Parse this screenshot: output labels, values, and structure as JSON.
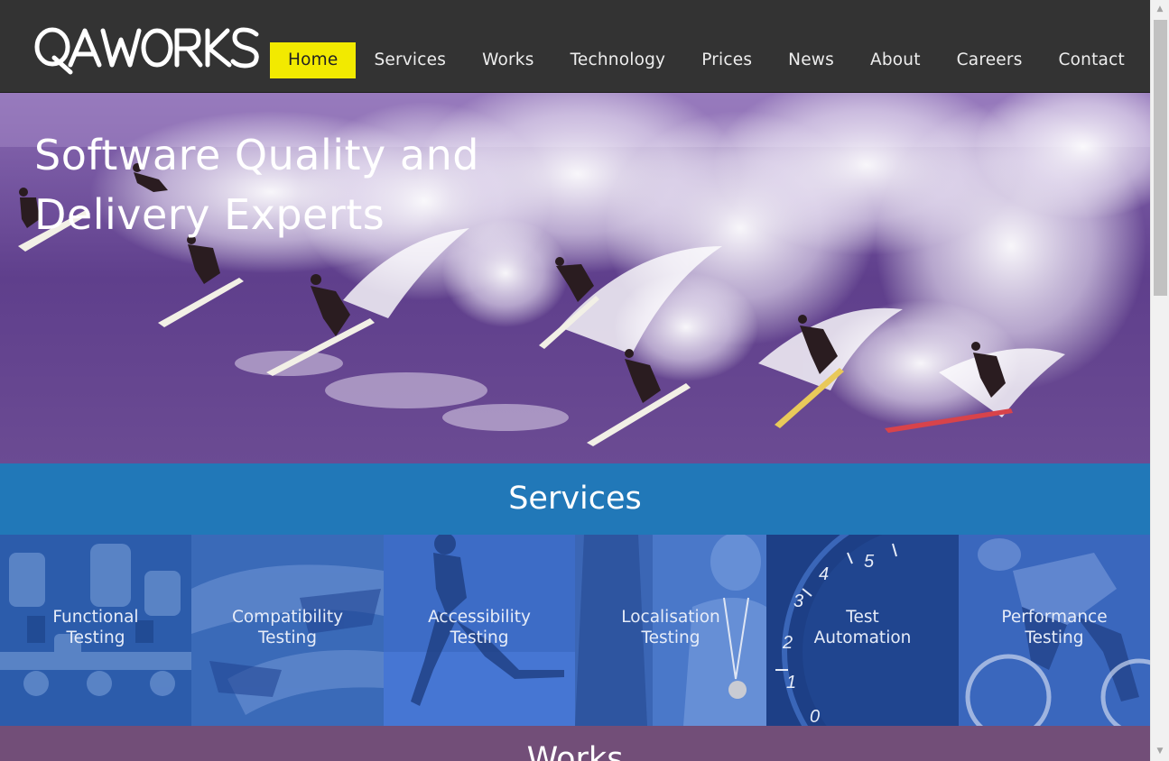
{
  "brand": {
    "logo_text": "QAWORKS"
  },
  "nav": {
    "items": [
      {
        "label": "Home",
        "active": true
      },
      {
        "label": "Services",
        "active": false
      },
      {
        "label": "Works",
        "active": false
      },
      {
        "label": "Technology",
        "active": false
      },
      {
        "label": "Prices",
        "active": false
      },
      {
        "label": "News",
        "active": false
      },
      {
        "label": "About",
        "active": false
      },
      {
        "label": "Careers",
        "active": false
      },
      {
        "label": "Contact",
        "active": false
      }
    ]
  },
  "hero": {
    "title_line1": "Software Quality and",
    "title_line2": "Delivery Experts"
  },
  "services": {
    "heading": "Services",
    "tiles": [
      {
        "line1": "Functional",
        "line2": "Testing",
        "icon": "engine-image"
      },
      {
        "line1": "Compatibility",
        "line2": "Testing",
        "icon": "bobsleigh-image"
      },
      {
        "line1": "Accessibility",
        "line2": "Testing",
        "icon": "runner-image"
      },
      {
        "line1": "Localisation",
        "line2": "Testing",
        "icon": "medal-athlete-image"
      },
      {
        "line1": "Test",
        "line2": "Automation",
        "icon": "speedometer-image"
      },
      {
        "line1": "Performance",
        "line2": "Testing",
        "icon": "cyclist-image"
      }
    ]
  },
  "works": {
    "heading": "Works"
  },
  "colors": {
    "header_bg": "#333333",
    "active_nav": "#f2ea00",
    "services_band": "#2178b8",
    "tile_blue": "#2f5fae",
    "works_band": "#724e78",
    "hero_purple": "#6a4a93"
  }
}
